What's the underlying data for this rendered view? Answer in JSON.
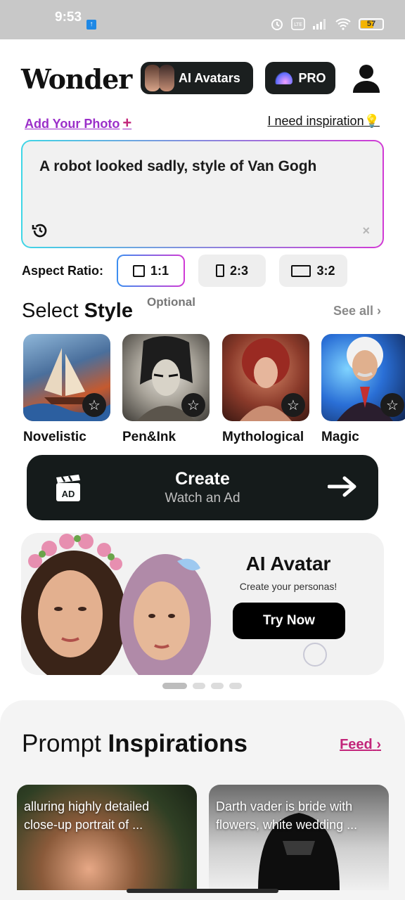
{
  "status": {
    "time": "9:53",
    "battery": "57"
  },
  "header": {
    "logo": "Wonder",
    "avatars_label": "AI Avatars",
    "pro_label": "PRO"
  },
  "links": {
    "add_photo": "Add Your Photo",
    "add_photo_plus": "+",
    "inspiration": "I need inspiration",
    "inspiration_emoji": "💡"
  },
  "prompt": {
    "text": "A robot looked sadly, style of Van Gogh",
    "clear": "×"
  },
  "aspect": {
    "label": "Aspect Ratio:",
    "options": [
      "1:1",
      "2:3",
      "3:2"
    ],
    "selected": "1:1"
  },
  "styles_section": {
    "title_light": "Select",
    "title_bold": "Style",
    "optional": "Optional",
    "see_all": "See all",
    "see_all_chevron": "›",
    "items": [
      "Novelistic",
      "Pen&Ink",
      "Mythological",
      "Magic"
    ]
  },
  "create": {
    "title": "Create",
    "subtitle": "Watch an Ad",
    "ad_badge": "AD"
  },
  "banner": {
    "title": "AI Avatar",
    "subtitle": "Create your personas!",
    "button": "Try Now"
  },
  "inspirations": {
    "title_light": "Prompt",
    "title_bold": "Inspirations",
    "feed": "Feed",
    "feed_chevron": "›",
    "cards": [
      "alluring highly detailed close-up portrait of ...",
      "Darth vader is bride with flowers, white wedding ..."
    ]
  },
  "colors": {
    "accent_purple": "#9b2fc9",
    "accent_pink": "#c2257a",
    "dark": "#151b1b"
  }
}
